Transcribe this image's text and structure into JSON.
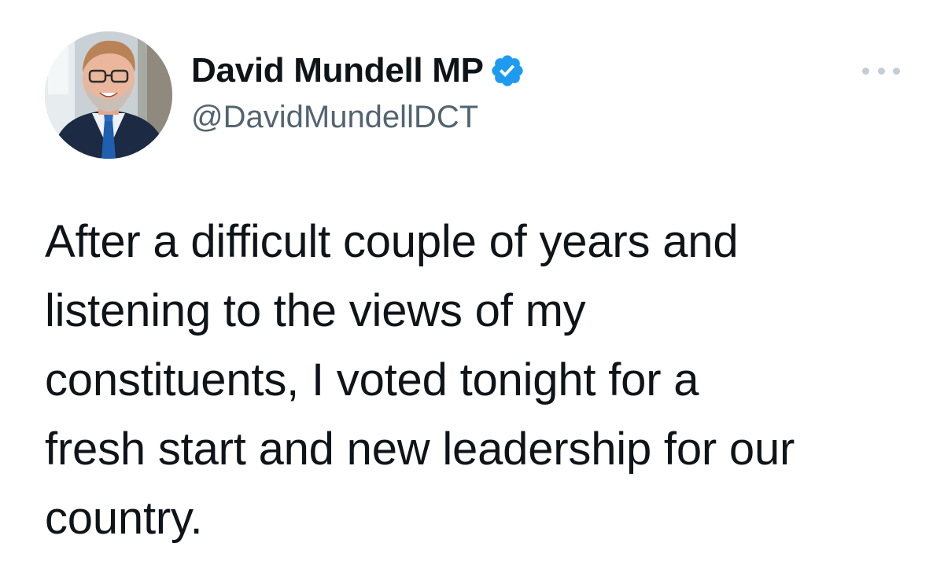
{
  "tweet": {
    "author": {
      "display_name": "David Mundell MP",
      "handle": "@DavidMundellDCT",
      "verified": true
    },
    "text_lines": [
      "After a difficult couple of years and",
      "listening to the views of my",
      "constituents, I voted tonight for a",
      "fresh start and new leadership for our",
      "country."
    ],
    "icons": {
      "verified": "verified-badge-icon",
      "more": "more-options-icon"
    },
    "colors": {
      "verified_blue": "#1d9bf0",
      "text_primary": "#0f1419",
      "text_secondary": "#536471",
      "more_dots": "#c4cdd4"
    }
  }
}
